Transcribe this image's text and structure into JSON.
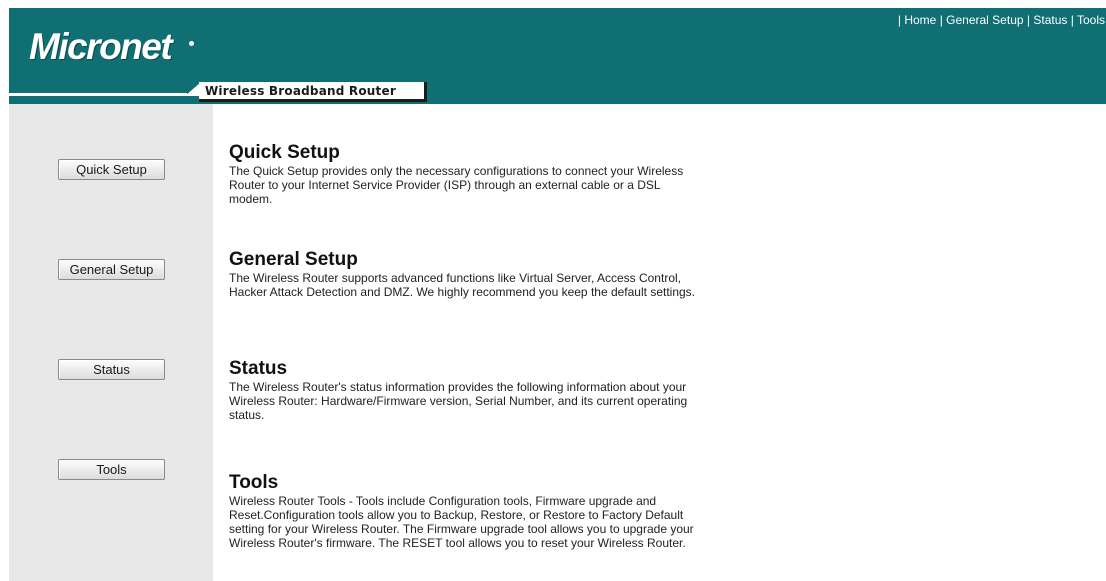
{
  "header": {
    "logo_text": "Micronet",
    "product_name": "Wireless Broadband Router",
    "background_color": "#0f6f73",
    "top_links": [
      {
        "label": "Home"
      },
      {
        "label": "General Setup"
      },
      {
        "label": "Status"
      },
      {
        "label": "Tools"
      }
    ],
    "separator": "|"
  },
  "sidebar": {
    "buttons": [
      {
        "label": "Quick Setup"
      },
      {
        "label": "General Setup"
      },
      {
        "label": "Status"
      },
      {
        "label": "Tools"
      }
    ]
  },
  "main": {
    "sections": [
      {
        "title": "Quick Setup",
        "text": "The Quick Setup provides only the necessary configurations to connect your Wireless Router to your Internet Service Provider (ISP) through an external cable or a DSL modem."
      },
      {
        "title": "General Setup",
        "text": "The Wireless Router supports advanced functions like Virtual Server, Access Control, Hacker Attack Detection and DMZ. We highly recommend you keep the default settings."
      },
      {
        "title": "Status",
        "text": "The Wireless Router's status information provides the following information about your Wireless Router: Hardware/Firmware version, Serial Number, and its current operating status."
      },
      {
        "title": "Tools",
        "text": "Wireless Router Tools - Tools include Configuration tools, Firmware upgrade and Reset.Configuration tools allow you to Backup, Restore, or Restore to Factory Default setting for your Wireless Router. The Firmware upgrade tool allows you to upgrade your Wireless Router's firmware. The RESET tool allows you to reset your Wireless Router."
      }
    ]
  }
}
